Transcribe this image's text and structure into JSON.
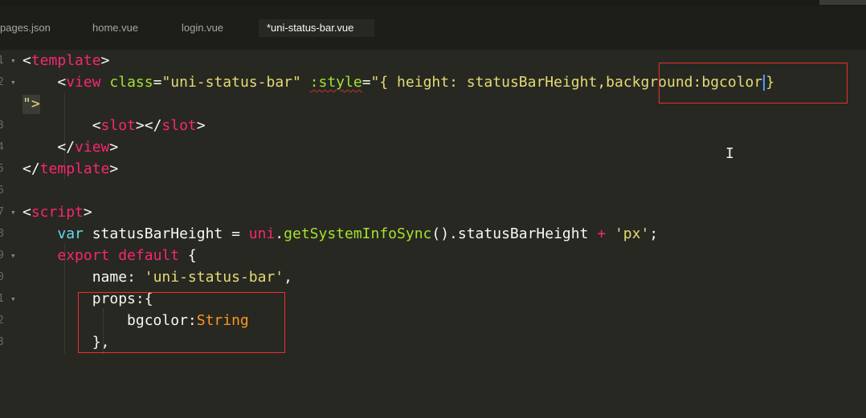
{
  "tabs": [
    {
      "label": "pages.json",
      "active": false
    },
    {
      "label": "home.vue",
      "active": false
    },
    {
      "label": "login.vue",
      "active": false
    },
    {
      "label": "*uni-status-bar.vue",
      "active": true
    }
  ],
  "gutter": {
    "lines": [
      "1",
      "2",
      "",
      "3",
      "4",
      "5",
      "6",
      "7",
      "8",
      "9",
      "0",
      "1",
      "2",
      "3"
    ]
  },
  "code": {
    "l1": {
      "open": "<",
      "tag": "template",
      "close": ">"
    },
    "l2": {
      "open": "<",
      "tag": "view",
      "sp": " ",
      "attr1": "class",
      "eq1": "=",
      "val1": "\"uni-status-bar\"",
      "sp2": " ",
      "attr2": ":style",
      "eq2": "=",
      "val2a": "\"{ height: statusBarHeight",
      "val2b": ",background:bgcolor",
      "val2c": "}"
    },
    "l2wrap": {
      "text": "\">"
    },
    "l3": {
      "a": "<",
      "tag1": "slot",
      "b": "></",
      "tag2": "slot",
      "c": ">"
    },
    "l4": {
      "a": "</",
      "tag": "view",
      "b": ">"
    },
    "l5": {
      "a": "</",
      "tag": "template",
      "b": ">"
    },
    "l7": {
      "a": "<",
      "tag": "script",
      "b": ">"
    },
    "l8": {
      "kw": "var",
      "name": " statusBarHeight = ",
      "obj": "uni",
      "dot": ".",
      "fn": "getSystemInfoSync",
      "rest": "().statusBarHeight ",
      "plus": "+",
      "sp": " ",
      "str": "'px'",
      "semi": ";"
    },
    "l9": {
      "kw1": "export",
      "kw2": "default",
      "brace": " {"
    },
    "l10": {
      "key": "name",
      "colon": ": ",
      "str": "'uni-status-bar'",
      "comma": ","
    },
    "l11": {
      "key": "props",
      "rest": ":{"
    },
    "l12": {
      "key": "bgcolor",
      "colon": ":",
      "type": "String"
    },
    "l13": {
      "text": "},"
    }
  },
  "colors": {
    "background": "#272822",
    "tag": "#f92672",
    "attribute": "#a6e22e",
    "string": "#e6db74",
    "keyword": "#66d9ef",
    "type": "#fd971f",
    "annotation_box": "#e8312f",
    "cursor": "#4a9cff"
  },
  "icons": {
    "ibeam": "text-cursor-icon",
    "ibeam_glyph": "I"
  }
}
